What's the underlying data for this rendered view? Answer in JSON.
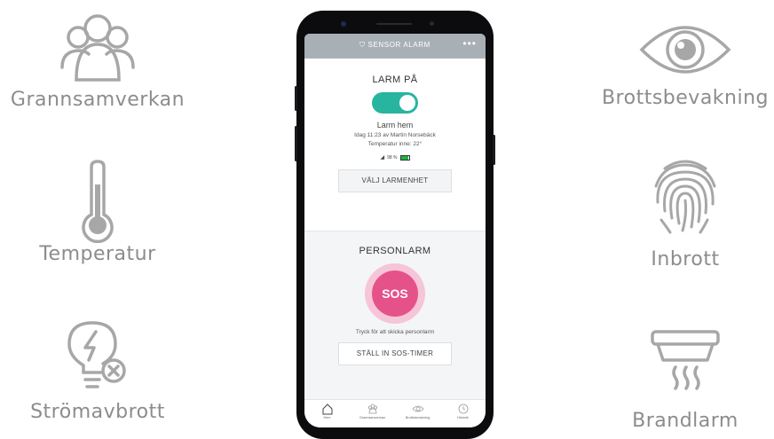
{
  "features": {
    "left": [
      {
        "label": "Grannsamverkan",
        "icon": "people-group-icon"
      },
      {
        "label": "Temperatur",
        "icon": "thermometer-icon"
      },
      {
        "label": "Strömavbrott",
        "icon": "bulb-power-off-icon"
      }
    ],
    "right": [
      {
        "label": "Brottsbevakning",
        "icon": "eye-icon"
      },
      {
        "label": "Inbrott",
        "icon": "fingerprint-icon"
      },
      {
        "label": "Brandlarm",
        "icon": "smoke-detector-icon"
      }
    ]
  },
  "app": {
    "brand": "SENSOR ALARM",
    "menu": "•••",
    "alarm": {
      "title": "LARM PÅ",
      "toggle_on": true,
      "status": "Larm hem",
      "detail": "Idag 11:23 av Martin Norsebäck",
      "temperature": "Temperatur inne: 22°",
      "battery_text": "98 %",
      "battery_level": 0.98,
      "select_button": "VÄLJ LARMENHET"
    },
    "personal": {
      "title": "PERSONLARM",
      "sos": "SOS",
      "hint": "Tryck för att skicka personlarm",
      "timer_button": "STÄLL IN SOS-TIMER"
    },
    "tabs": [
      {
        "label": "Hem",
        "icon": "home-icon"
      },
      {
        "label": "Grannsamverkan",
        "icon": "people-group-icon"
      },
      {
        "label": "Brottsbevakning",
        "icon": "eye-icon"
      },
      {
        "label": "Historik",
        "icon": "clock-icon"
      }
    ]
  },
  "colors": {
    "accent": "#28b5a0",
    "sos": "#e5528a",
    "sos_ring": "#f6c5d8",
    "topbar": "#a9b0b5",
    "feature_gray": "#8c8c8c"
  }
}
